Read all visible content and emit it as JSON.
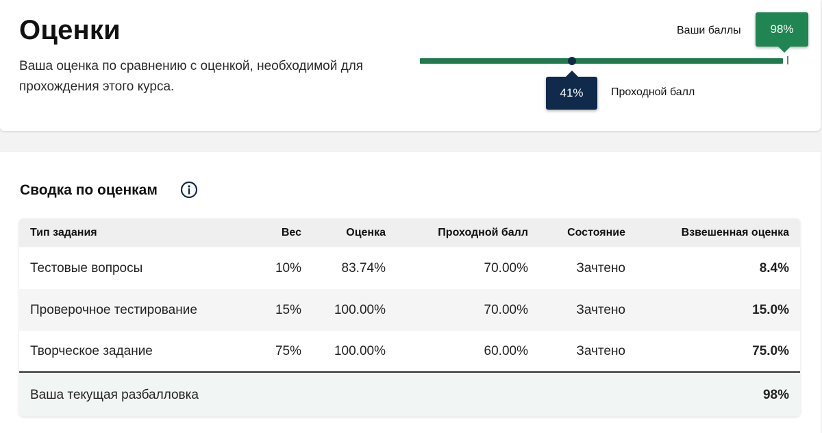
{
  "header": {
    "title": "Оценки",
    "description": "Ваша оценка по сравнению с оценкой, необходимой для прохождения этого курса."
  },
  "progress": {
    "your_score_label": "Ваши баллы",
    "your_score_value": "98%",
    "your_score_fraction": 0.98,
    "passing_label": "Проходной балл",
    "passing_value": "41%",
    "passing_fraction": 0.41,
    "bar_color": "#1f7a4d",
    "score_badge_color": "#1f8552",
    "passing_badge_color": "#0f2a4a"
  },
  "summary": {
    "title": "Сводка по оценкам",
    "info_icon": "info-circle-icon",
    "columns": [
      "Тип задания",
      "Вес",
      "Оценка",
      "Проходной балл",
      "Состояние",
      "Взвешенная оценка"
    ],
    "rows": [
      {
        "type": "Тестовые вопросы",
        "weight": "10%",
        "score": "83.74%",
        "passing": "70.00%",
        "state": "Зачтено",
        "weighted": "8.4%"
      },
      {
        "type": "Проверочное тестирование",
        "weight": "15%",
        "score": "100.00%",
        "passing": "70.00%",
        "state": "Зачтено",
        "weighted": "15.0%"
      },
      {
        "type": "Творческое задание",
        "weight": "75%",
        "score": "100.00%",
        "passing": "60.00%",
        "state": "Зачтено",
        "weighted": "75.0%"
      }
    ],
    "total": {
      "label": "Ваша текущая разбалловка",
      "value": "98%"
    }
  }
}
